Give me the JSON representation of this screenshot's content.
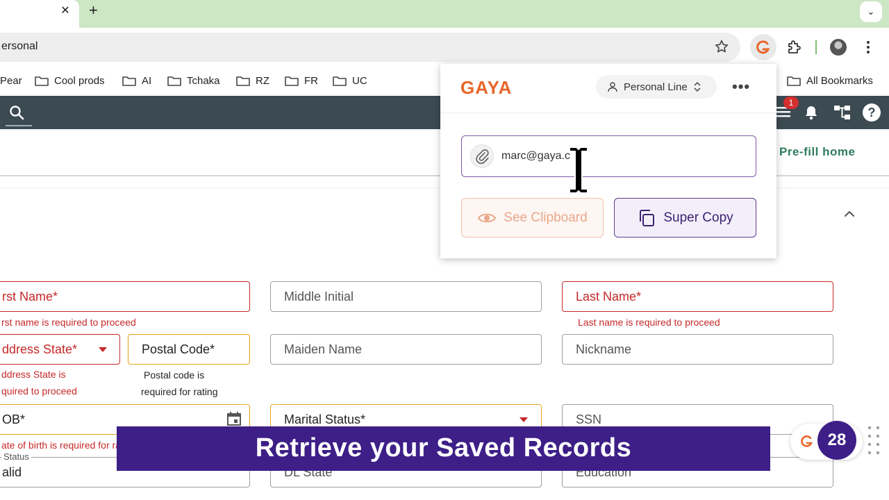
{
  "browser": {
    "tab_close": "✕",
    "new_tab": "+",
    "tab_menu": "⌄",
    "address_text": "ersonal",
    "bookmarks": [
      "Pear",
      "Cool prods",
      "AI",
      "Tchaka",
      "RZ",
      "FR",
      "UC"
    ],
    "all_bookmarks": "All Bookmarks"
  },
  "app": {
    "notification_count": "1",
    "help": "?",
    "prefill_label": "Pre-fill home"
  },
  "form": {
    "first_name": "rst Name*",
    "first_name_error": "rst name is required to proceed",
    "middle_initial": "Middle Initial",
    "last_name": "Last Name*",
    "last_name_error": "Last name is required to proceed",
    "address_state": "ddress State*",
    "address_state_error_1": "ddress State is",
    "address_state_error_2": "quired to proceed",
    "postal_code": "Postal Code*",
    "postal_code_help_1": "Postal code is",
    "postal_code_help_2": "required for rating",
    "maiden_name": "Maiden Name",
    "nickname": "Nickname",
    "dob": "OB*",
    "dob_error": "ate of birth is required for rating",
    "marital_status": "Marital Status*",
    "ssn": "SSN",
    "dl_status_label": "Status",
    "dl_status_value": "alid",
    "dl_state": "DL State",
    "education": "Education"
  },
  "gaya": {
    "logo": "GAYA",
    "line_select": "Personal Line",
    "clipboard_value": "marc@gaya.c",
    "see_clipboard": "See Clipboard",
    "super_copy": "Super Copy"
  },
  "overlay": {
    "caption": "Retrieve your Saved Records",
    "badge_count": "28"
  },
  "colors": {
    "gaya_orange": "#e8662a",
    "gaya_purple": "#3d1f87",
    "error_red": "#c62828",
    "header_slate": "#3c4a52"
  }
}
